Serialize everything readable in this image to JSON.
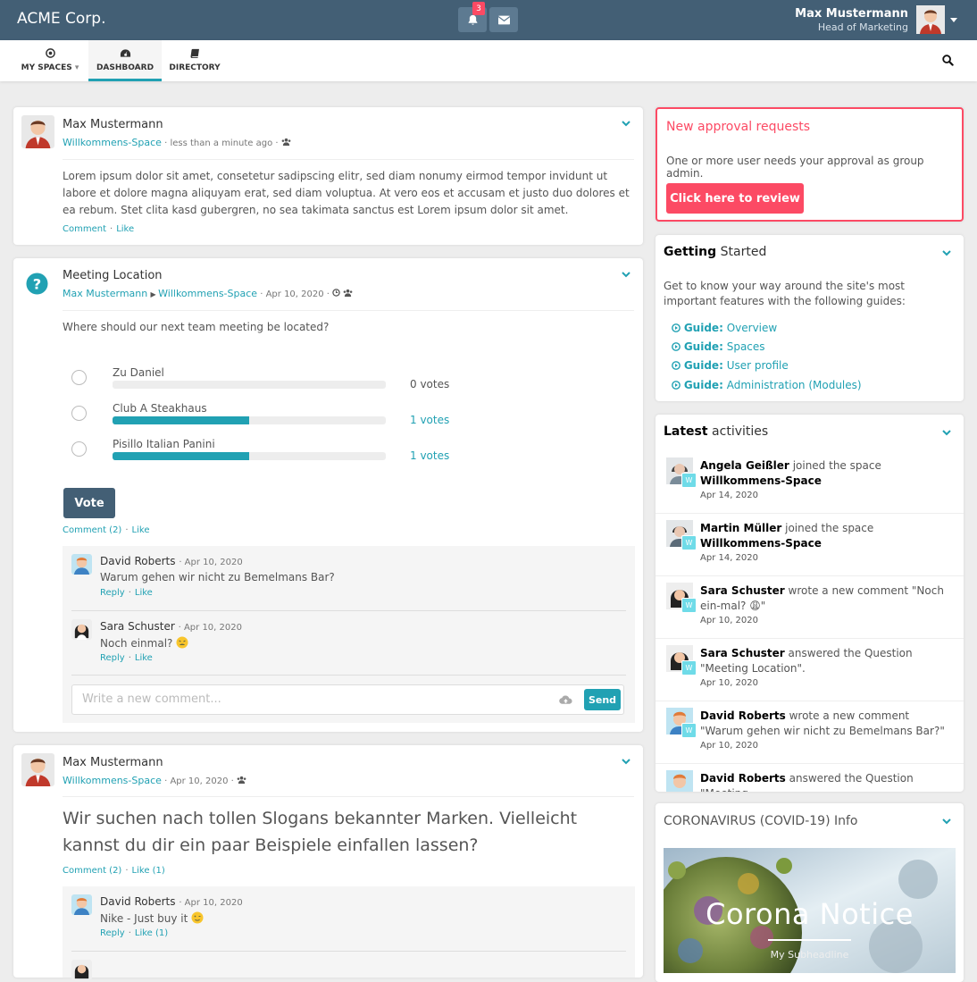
{
  "topbar": {
    "brand": "ACME Corp.",
    "notifications_count": "3",
    "user_name": "Max Mustermann",
    "user_title": "Head of Marketing"
  },
  "nav": {
    "my_spaces": "MY SPACES",
    "dashboard": "DASHBOARD",
    "directory": "DIRECTORY"
  },
  "post1": {
    "author": "Max Mustermann",
    "space": "Willkommens-Space",
    "time": "· less than a minute ago ·",
    "body": "Lorem ipsum dolor sit amet, consetetur sadipscing elitr, sed diam nonumy eirmod tempor invidunt ut labore et dolore magna aliquyam erat, sed diam voluptua. At vero eos et accusam et justo duo dolores et ea rebum. Stet clita kasd gubergren, no sea takimata sanctus est Lorem ipsum dolor sit amet.",
    "comment": "Comment",
    "like": "Like"
  },
  "poll": {
    "title": "Meeting Location",
    "author": "Max Mustermann",
    "space": "Willkommens-Space",
    "time": "· Apr 10, 2020 ·",
    "question": "Where should our next team meeting be located?",
    "options": [
      {
        "label": "Zu Daniel",
        "votes": "0 votes",
        "share": 0
      },
      {
        "label": "Club A Steakhaus",
        "votes": "1 votes",
        "share": 0.5
      },
      {
        "label": "Pisillo Italian Panini",
        "votes": "1 votes",
        "share": 0.5
      }
    ],
    "vote_button": "Vote",
    "comment": "Comment (2)",
    "like": "Like",
    "comments": [
      {
        "name": "David Roberts",
        "date": "· Apr 10, 2020",
        "text": "Warum gehen wir nicht zu Bemelmans Bar?",
        "reply": "Reply",
        "like": "Like"
      },
      {
        "name": "Sara Schuster",
        "date": "· Apr 10, 2020",
        "text": "Noch einmal?",
        "reply": "Reply",
        "like": "Like"
      }
    ],
    "input_placeholder": "Write a new comment...",
    "send": "Send"
  },
  "post3": {
    "author": "Max Mustermann",
    "space": "Willkommens-Space",
    "time": "· Apr 10, 2020 ·",
    "body": "Wir suchen nach tollen Slogans bekannter Marken. Vielleicht kannst du dir ein paar Beispiele einfallen lassen?",
    "comment": "Comment (2)",
    "like": "Like (1)",
    "comments": [
      {
        "name": "David Roberts",
        "date": "· Apr 10, 2020",
        "text": "Nike - Just buy it",
        "reply": "Reply",
        "like": "Like (1)"
      }
    ]
  },
  "approval": {
    "title": "New approval requests",
    "text": "One or more user needs your approval as group admin.",
    "button": "Click here to review"
  },
  "getting_started": {
    "title_bold": "Getting",
    "title_rest": "Started",
    "text": "Get to know your way around the site's most important features with the following guides:",
    "guide_prefix": "Guide:",
    "guides": [
      "Overview",
      "Spaces",
      "User profile",
      "Administration (Modules)"
    ]
  },
  "activities": {
    "title_bold": "Latest",
    "title_rest": "activities",
    "items": [
      {
        "user": "Angela Geißler",
        "action": "joined the space",
        "target": "Willkommens-Space",
        "date": "Apr 14, 2020"
      },
      {
        "user": "Martin Müller",
        "action": "joined the space",
        "target": "Willkommens-Space",
        "date": "Apr 14, 2020"
      },
      {
        "user": "Sara Schuster",
        "action": "wrote a new comment \"Noch ein-mal? 😩\"",
        "target": "",
        "date": "Apr 10, 2020"
      },
      {
        "user": "Sara Schuster",
        "action": "answered the Question \"Meeting Location\".",
        "target": "",
        "date": "Apr 10, 2020"
      },
      {
        "user": "David Roberts",
        "action": "wrote a new comment \"Warum gehen wir nicht zu Bemelmans Bar?\"",
        "target": "",
        "date": "Apr 10, 2020"
      },
      {
        "user": "David Roberts",
        "action": "answered the Question \"Meeting",
        "target": "",
        "date": ""
      }
    ]
  },
  "covid": {
    "title": "CORONAVIRUS (COVID-19) Info",
    "image_title": "Corona Notice",
    "image_sub": "My Subheadline"
  },
  "colors": {
    "topbar": "#435f75",
    "accent": "#21a1b3",
    "danger": "#fc4a64"
  }
}
